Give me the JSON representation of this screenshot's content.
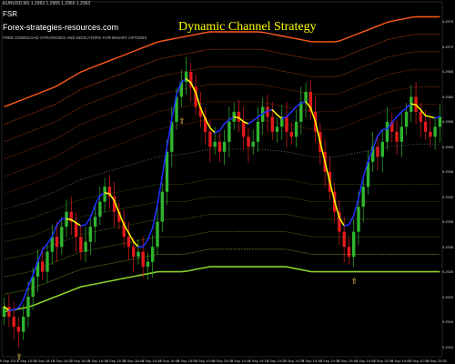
{
  "header": {
    "symbol_line": "EURUSD,M1  1.2963 1.2965 1.2960 1.2963",
    "brand_short": "FSR",
    "site": "Forex-strategies-resources.com",
    "tagline": "FREE DOWNLOAD STRATEGIES AND INDICATORS FOR BINARY OPTIONS",
    "strategy_title": "Dynamic Channel Strategy"
  },
  "colors": {
    "background": "#000000",
    "bull_candle": "#2fb52f",
    "bear_candle": "#e01a1a",
    "upper_channel": "#ff5a1a",
    "lower_channel": "#8bd12a",
    "trend_up": "#2230ff",
    "trend_down": "#ffff00",
    "signal_arrow": "#ffd35a"
  },
  "icons": {
    "buy_arrow": "up-arrow-icon"
  },
  "chart_data": {
    "type": "candlestick",
    "price_axis_ticks": [
      "1.2975",
      "1.2970",
      "1.2965",
      "1.2960",
      "1.2955",
      "1.2950",
      "1.2945",
      "1.2940",
      "1.2935",
      "1.2930",
      "1.2925",
      "1.2920",
      "1.2915",
      "1.2910"
    ],
    "time_axis_ticks": [
      "5 Sep 2017",
      "5 Sep 18:10",
      "5 Sep 18:15",
      "5 Sep 18:20",
      "5 Sep 18:25",
      "5 Sep 18:30",
      "5 Sep 18:35",
      "5 Sep 18:40",
      "5 Sep 18:45",
      "5 Sep 18:50",
      "5 Sep 18:55",
      "5 Sep 19:00",
      "5 Sep 19:05",
      "5 Sep 19:10",
      "5 Sep 19:15",
      "5 Sep 19:20",
      "5 Sep 19:25",
      "5 Sep 19:30",
      "5 Sep 19:35",
      "5 Sep 19:40",
      "5 Sep 19:45",
      "5 Sep 19:50",
      "5 Sep 19:55",
      "5 Sep 20:00",
      "5 Sep 20:05"
    ],
    "close": [
      1.2918,
      1.2916,
      1.2914,
      1.2913,
      1.2916,
      1.292,
      1.2924,
      1.2927,
      1.2925,
      1.2929,
      1.2932,
      1.293,
      1.2934,
      1.2937,
      1.2935,
      1.2932,
      1.2929,
      1.2931,
      1.2934,
      1.2936,
      1.2939,
      1.2942,
      1.294,
      1.2937,
      1.2935,
      1.2932,
      1.293,
      1.2928,
      1.2929,
      1.2926,
      1.2927,
      1.293,
      1.2935,
      1.2941,
      1.2949,
      1.2955,
      1.296,
      1.2963,
      1.2965,
      1.2962,
      1.2958,
      1.2956,
      1.2953,
      1.295,
      1.2951,
      1.2949,
      1.2951,
      1.2955,
      1.2957,
      1.2955,
      1.2952,
      1.295,
      1.2951,
      1.2955,
      1.2958,
      1.2956,
      1.2953,
      1.2954,
      1.2956,
      1.2953,
      1.2952,
      1.2955,
      1.2959,
      1.2961,
      1.2957,
      1.2953,
      1.2949,
      1.2945,
      1.2941,
      1.2937,
      1.2933,
      1.293,
      1.2928,
      1.2933,
      1.2938,
      1.2942,
      1.2947,
      1.295,
      1.2948,
      1.2951,
      1.2955,
      1.2953,
      1.2951,
      1.2954,
      1.2957,
      1.296,
      1.2957,
      1.2955,
      1.2953,
      1.2952,
      1.2954,
      1.2956
    ],
    "upper_channel_base": [
      1.2958,
      1.296,
      1.2962,
      1.2965,
      1.2967,
      1.2969,
      1.2971,
      1.2972,
      1.2973,
      1.2973,
      1.2973,
      1.2972,
      1.2971,
      1.2971,
      1.2973,
      1.2975,
      1.2976,
      1.2976
    ],
    "lower_channel_base": [
      1.2917,
      1.2918,
      1.292,
      1.2922,
      1.2923,
      1.2924,
      1.2925,
      1.2925,
      1.2926,
      1.2926,
      1.2926,
      1.2926,
      1.2925,
      1.2925,
      1.2925,
      1.2925,
      1.2925,
      1.2925
    ],
    "channel_band_spacing": 0.00035,
    "upper_band_count": 6,
    "lower_band_count": 6,
    "signal_arrows_at_bar": [
      3,
      37,
      73
    ],
    "ylim": [
      1.2908,
      1.2979
    ]
  }
}
